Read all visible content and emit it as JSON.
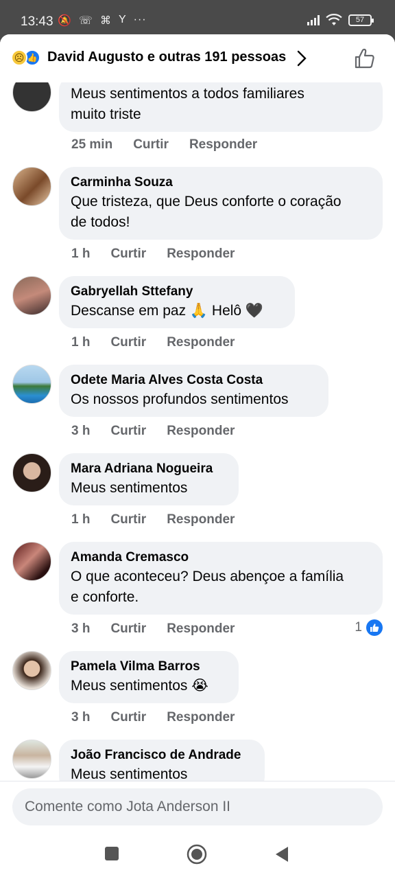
{
  "status": {
    "time": "13:43",
    "icons": [
      "mute-icon",
      "call-icon",
      "nfc-icon",
      "data-icon",
      "more-dots-icon"
    ],
    "battery": "57"
  },
  "header": {
    "title": "David Augusto e outras 191 pessoas",
    "reactions": [
      "sad-reaction-icon",
      "like-reaction-icon"
    ]
  },
  "comments": [
    {
      "name": "",
      "text1": "Meus sentimentos a todos familiares",
      "text2": "muito triste",
      "time": "25 min",
      "like": "Curtir",
      "reply": "Responder"
    },
    {
      "name": "Carminha Souza",
      "text1": "Que tristeza, que Deus conforte o coração",
      "text2": "de todos!",
      "time": "1 h",
      "like": "Curtir",
      "reply": "Responder"
    },
    {
      "name": "Gabryellah Sttefany",
      "text1": "Descanse em paz 🙏 Helô 🖤",
      "time": "1 h",
      "like": "Curtir",
      "reply": "Responder"
    },
    {
      "name": "Odete Maria Alves Costa Costa",
      "text1": "Os nossos profundos sentimentos",
      "time": "3 h",
      "like": "Curtir",
      "reply": "Responder"
    },
    {
      "name": "Mara Adriana Nogueira",
      "text1": "Meus sentimentos",
      "time": "1 h",
      "like": "Curtir",
      "reply": "Responder"
    },
    {
      "name": "Amanda Cremasco",
      "text1": "O que aconteceu? Deus abençoe a família",
      "text2": "e conforte.",
      "time": "3 h",
      "like": "Curtir",
      "reply": "Responder",
      "likes": "1"
    },
    {
      "name": "Pamela Vilma Barros",
      "text1": "Meus sentimentos 😭",
      "time": "3 h",
      "like": "Curtir",
      "reply": "Responder"
    },
    {
      "name": "João Francisco de Andrade",
      "text1": "Meus sentimentos"
    }
  ],
  "composer": {
    "placeholder": "Comente como Jota Anderson II"
  },
  "colors": {
    "accent": "#1877f2",
    "bubble": "#f0f2f5",
    "meta": "#65676b"
  }
}
